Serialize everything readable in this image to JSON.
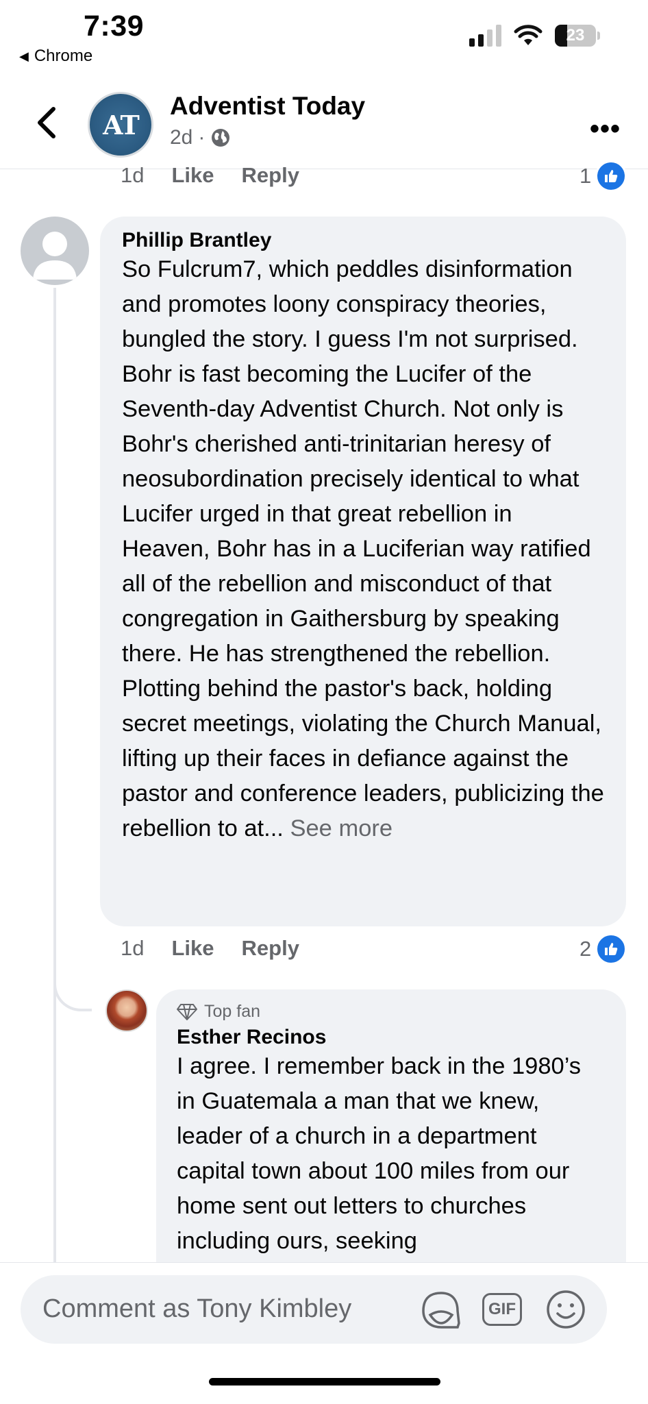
{
  "status_bar": {
    "time": "7:39",
    "back_app": "Chrome",
    "battery": "23"
  },
  "header": {
    "page_name": "Adventist Today",
    "avatar_initials": "AT",
    "age": "2d",
    "more_label": "•••"
  },
  "prev_comment": {
    "time": "1d",
    "like_label": "Like",
    "reply_label": "Reply",
    "like_count": "1"
  },
  "comment1": {
    "author": "Phillip Brantley",
    "text": "So Fulcrum7, which peddles disinformation and promotes loony conspiracy theories, bungled the story.  I guess I'm not surprised.  Bohr is fast becoming the Lucifer of the Seventh-day Adventist Church.  Not only is Bohr's cherished anti-trinitarian heresy of neosubordination precisely identical to what Lucifer urged in that great rebellion in Heaven, Bohr has in a Luciferian way ratified all of the rebellion and misconduct of that congregation in Gaithersburg by speaking there.  He has strengthened the rebellion.  Plotting behind the pastor's back, holding secret meetings, violating the Church Manual, lifting up their faces in defiance against the pastor and conference leaders, publicizing the rebellion to at...",
    "see_more": "See more",
    "time": "1d",
    "like_label": "Like",
    "reply_label": "Reply",
    "like_count": "2"
  },
  "reply1": {
    "badge": "Top fan",
    "author": "Esther Recinos",
    "text": "I agree.  I remember back in the 1980’s in Guatemala a man that we knew, leader of a church in a department capital town about 100 miles from our home sent out letters to churches including ours, seeking"
  },
  "composer": {
    "placeholder": "Comment as Tony Kimbley",
    "gif_label": "GIF"
  },
  "colors": {
    "accent": "#1b74e4",
    "bubble": "#f0f2f5",
    "secondary_text": "#65676b"
  }
}
